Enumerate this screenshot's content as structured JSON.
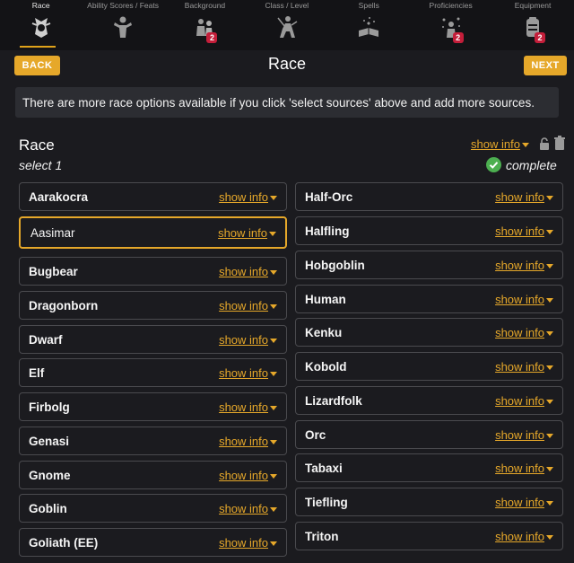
{
  "steps": [
    {
      "label": "Race",
      "icon": "race-icon",
      "active": true
    },
    {
      "label": "Ability Scores / Feats",
      "icon": "ability-icon"
    },
    {
      "label": "Background",
      "icon": "background-icon",
      "badge": "2"
    },
    {
      "label": "Class / Level",
      "icon": "class-icon"
    },
    {
      "label": "Spells",
      "icon": "spellbook-icon"
    },
    {
      "label": "Proficiencies",
      "icon": "proficiencies-icon",
      "badge": "2"
    },
    {
      "label": "Equipment",
      "icon": "equipment-icon",
      "badge": "2"
    }
  ],
  "header": {
    "back": "BACK",
    "title": "Race",
    "next": "NEXT"
  },
  "notice": "There are more race options available if you click 'select sources' above and add more sources.",
  "section": {
    "title": "Race",
    "subtitle": "select 1",
    "show_info": "show info",
    "status": "complete"
  },
  "races_left": [
    {
      "name": "Aarakocra",
      "info": "show info"
    },
    {
      "name": "Aasimar",
      "info": "show info",
      "selected": true
    },
    {
      "name": "Bugbear",
      "info": "show info"
    },
    {
      "name": "Dragonborn",
      "info": "show info"
    },
    {
      "name": "Dwarf",
      "info": "show info"
    },
    {
      "name": "Elf",
      "info": "show info"
    },
    {
      "name": "Firbolg",
      "info": "show info"
    },
    {
      "name": "Genasi",
      "info": "show info"
    },
    {
      "name": "Gnome",
      "info": "show info"
    },
    {
      "name": "Goblin",
      "info": "show info"
    },
    {
      "name": "Goliath (EE)",
      "info": "show info"
    }
  ],
  "races_right": [
    {
      "name": "Half-Orc",
      "info": "show info"
    },
    {
      "name": "Halfling",
      "info": "show info"
    },
    {
      "name": "Hobgoblin",
      "info": "show info"
    },
    {
      "name": "Human",
      "info": "show info"
    },
    {
      "name": "Kenku",
      "info": "show info"
    },
    {
      "name": "Kobold",
      "info": "show info"
    },
    {
      "name": "Lizardfolk",
      "info": "show info"
    },
    {
      "name": "Orc",
      "info": "show info"
    },
    {
      "name": "Tabaxi",
      "info": "show info"
    },
    {
      "name": "Tiefling",
      "info": "show info"
    },
    {
      "name": "Triton",
      "info": "show info"
    }
  ],
  "colors": {
    "accent": "#e6a82a",
    "badge": "#c41e3a",
    "complete": "#4caf50"
  }
}
